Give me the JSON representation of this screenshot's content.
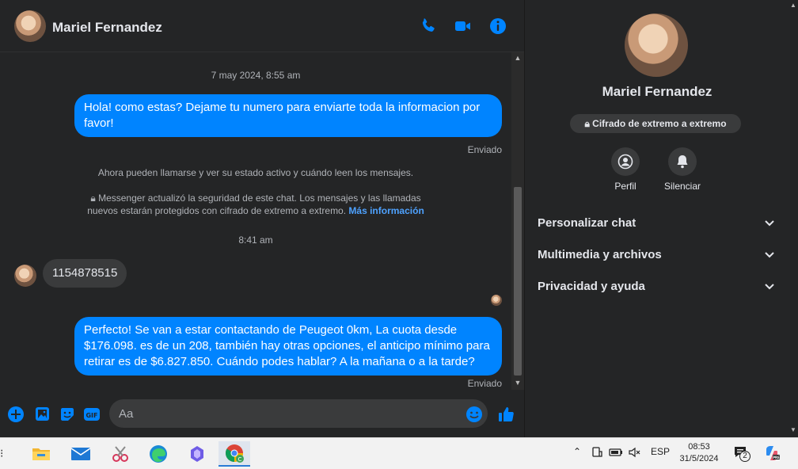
{
  "chat": {
    "contact_name": "Mariel Fernandez",
    "messages": {
      "timestamp1": "7 may 2024, 8:55 am",
      "out1": "Hola! como estas? Dejame tu numero para enviarte toda la informacion por favor!",
      "status1": "Enviado",
      "sys1": "Ahora pueden llamarse y ver su estado activo y cuándo leen los mensajes.",
      "sys2_line1": "Messenger actualizó la seguridad de este chat. Los mensajes y las llamadas",
      "sys2_line2": "nuevos estarán protegidos con cifrado de extremo a extremo.",
      "sys2_link": "Más información",
      "timestamp2": "8:41 am",
      "in1": "1154878515",
      "out2": "Perfecto!  Se van a estar contactando de Peugeot 0km, La cuota desde $176.098. es de un 208, también hay otras opciones, el anticipo mínimo para retirar es de $6.827.850. Cuándo podes hablar? A la mañana o a la tarde?",
      "status2": "Enviado"
    },
    "composer": {
      "placeholder": "Aa"
    }
  },
  "panel": {
    "name": "Mariel Fernandez",
    "encryption_badge": "Cifrado de extremo a extremo",
    "actions": {
      "profile": "Perfil",
      "mute": "Silenciar"
    },
    "sections": {
      "customize": "Personalizar chat",
      "media": "Multimedia y archivos",
      "privacy": "Privacidad y ayuda"
    }
  },
  "taskbar": {
    "language": "ESP",
    "time": "08:53",
    "date": "31/5/2024",
    "notification_count": "2"
  },
  "colors": {
    "accent": "#0084ff",
    "background": "#242526",
    "bubble_in": "#3a3b3c",
    "text": "#e4e6eb"
  },
  "icons": [
    "phone-icon",
    "video-icon",
    "info-icon",
    "plus-icon",
    "photo-icon",
    "sticker-icon",
    "gif-icon",
    "emoji-icon",
    "like-icon",
    "profile-icon",
    "bell-icon",
    "lock-icon",
    "chevron-down-icon"
  ]
}
